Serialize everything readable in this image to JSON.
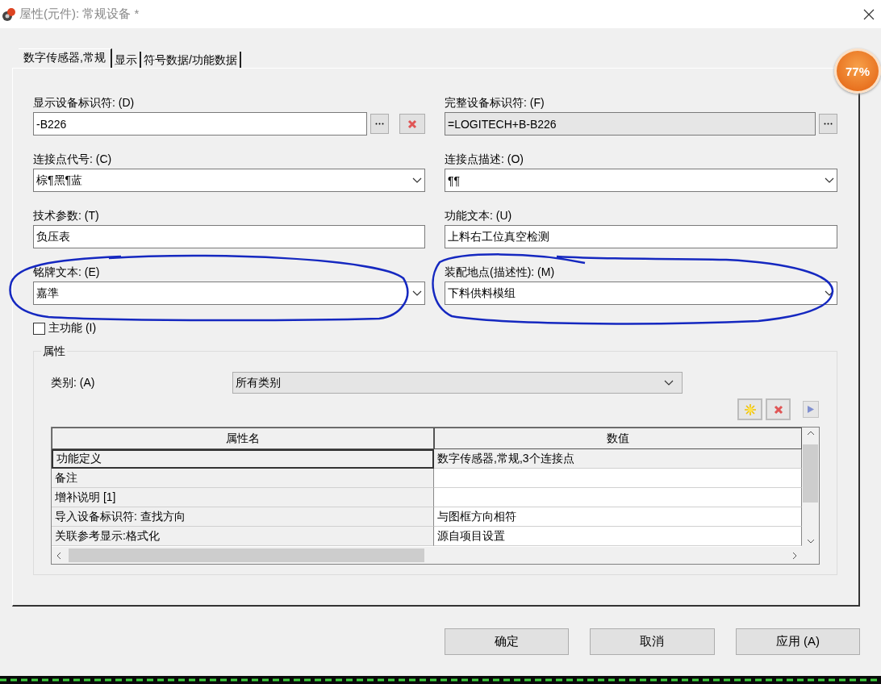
{
  "window": {
    "title": "屋性(元件): 常规设备 *"
  },
  "tabs": [
    {
      "label": "数字传感器,常规",
      "selected": true
    },
    {
      "label": "显示",
      "selected": false
    },
    {
      "label": "符号数据/功能数据",
      "selected": false
    }
  ],
  "fields": [
    {
      "label": "显示设备标识符: (D)",
      "value": "-B226",
      "kind": "text",
      "readonly": false,
      "actions": [
        {
          "kind": "browse"
        },
        {
          "kind": "clear"
        }
      ]
    },
    {
      "label": "完整设备标识符: (F)",
      "value": "=LOGITECH+B-B226",
      "kind": "text",
      "readonly": true,
      "actions": [
        {
          "kind": "browse"
        }
      ]
    },
    {
      "label": "连接点代号: (C)",
      "value": "棕¶黑¶蓝",
      "kind": "combo",
      "readonly": false
    },
    {
      "label": "连接点描述: (O)",
      "value": "¶¶",
      "kind": "combo",
      "readonly": false
    },
    {
      "label": "技术参数: (T)",
      "value": "负压表",
      "kind": "text",
      "readonly": false
    },
    {
      "label": "功能文本: (U)",
      "value": "上料右工位真空检测",
      "kind": "text",
      "readonly": false
    },
    {
      "label": "铭牌文本: (E)",
      "value": "嘉準",
      "kind": "combo",
      "readonly": false
    },
    {
      "label": "装配地点(描述性): (M)",
      "value": "下料供料模组",
      "kind": "combo",
      "readonly": false
    }
  ],
  "main_function": {
    "label": "主功能 (I)",
    "checked": false
  },
  "properties": {
    "title": "属性",
    "category_label": "类别: (A)",
    "category_value": "所有类别",
    "columns": [
      "属性名",
      "数值"
    ],
    "rows": [
      {
        "name": "功能定义",
        "value": "数字传感器,常规,3个连接点",
        "selected": true
      },
      {
        "name": "备注",
        "value": "",
        "selected": false
      },
      {
        "name": "增补说明 [1]",
        "value": "",
        "selected": false
      },
      {
        "name": "导入设备标识符: 查找方向",
        "value": "与图框方向相符",
        "selected": false
      },
      {
        "name": "关联参考显示:格式化",
        "value": "源自项目设置",
        "selected": false
      }
    ]
  },
  "buttons": [
    "确定",
    "取消",
    "应用 (A)"
  ],
  "badge": "77%"
}
